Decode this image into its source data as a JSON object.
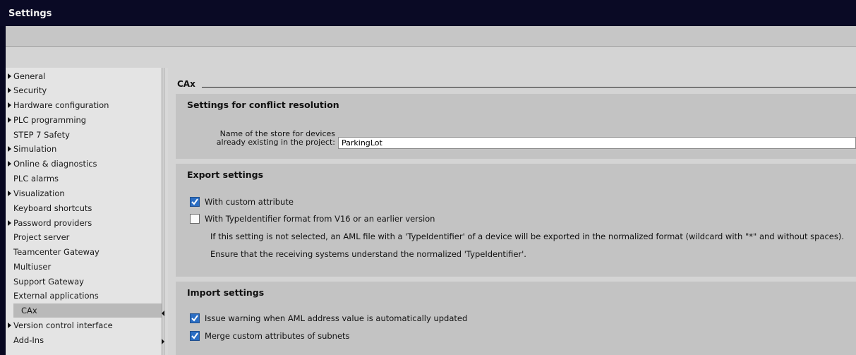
{
  "window": {
    "title": "Settings"
  },
  "nav": {
    "items": [
      {
        "label": "General",
        "expandable": true
      },
      {
        "label": "Security",
        "expandable": true
      },
      {
        "label": "Hardware configuration",
        "expandable": true
      },
      {
        "label": "PLC programming",
        "expandable": true
      },
      {
        "label": "STEP 7 Safety",
        "expandable": false
      },
      {
        "label": "Simulation",
        "expandable": true
      },
      {
        "label": "Online & diagnostics",
        "expandable": true
      },
      {
        "label": "PLC alarms",
        "expandable": false
      },
      {
        "label": "Visualization",
        "expandable": true
      },
      {
        "label": "Keyboard shortcuts",
        "expandable": false
      },
      {
        "label": "Password providers",
        "expandable": true
      },
      {
        "label": "Project server",
        "expandable": false
      },
      {
        "label": "Teamcenter Gateway",
        "expandable": false
      },
      {
        "label": "Multiuser",
        "expandable": false
      },
      {
        "label": "Support Gateway",
        "expandable": false
      },
      {
        "label": "External applications",
        "expandable": false
      },
      {
        "label": "CAx",
        "expandable": false,
        "selected": true
      },
      {
        "label": "Version control interface",
        "expandable": true
      },
      {
        "label": "Add-Ins",
        "expandable": false
      }
    ]
  },
  "content": {
    "section_title": "CAx",
    "conflict": {
      "header": "Settings for conflict resolution",
      "store_label_line1": "Name of the store for devices",
      "store_label_line2": "already existing in the project:",
      "store_value": "ParkingLot"
    },
    "export": {
      "header": "Export settings",
      "custom_attribute": {
        "label": "With custom attribute",
        "checked": true
      },
      "typeidentifier": {
        "label": "With TypeIdentifier format from V16 or an earlier version",
        "checked": false
      },
      "info1": "If this setting is not selected, an AML file with a 'TypeIdentifier' of a device will be exported in the normalized format (wildcard with \"*\" and without spaces).",
      "info2": "Ensure that the receiving systems understand the normalized 'TypeIdentifier'."
    },
    "import": {
      "header": "Import settings",
      "warn_address": {
        "label": "Issue warning when AML address value is automatically updated",
        "checked": true
      },
      "merge_subnets": {
        "label": "Merge custom attributes of subnets",
        "checked": true
      }
    }
  },
  "colors": {
    "title_bar": "#0a0a25",
    "panel": "#d4d4d4",
    "group": "#c3c3c3",
    "checkbox_checked": "#2b6ec4"
  }
}
